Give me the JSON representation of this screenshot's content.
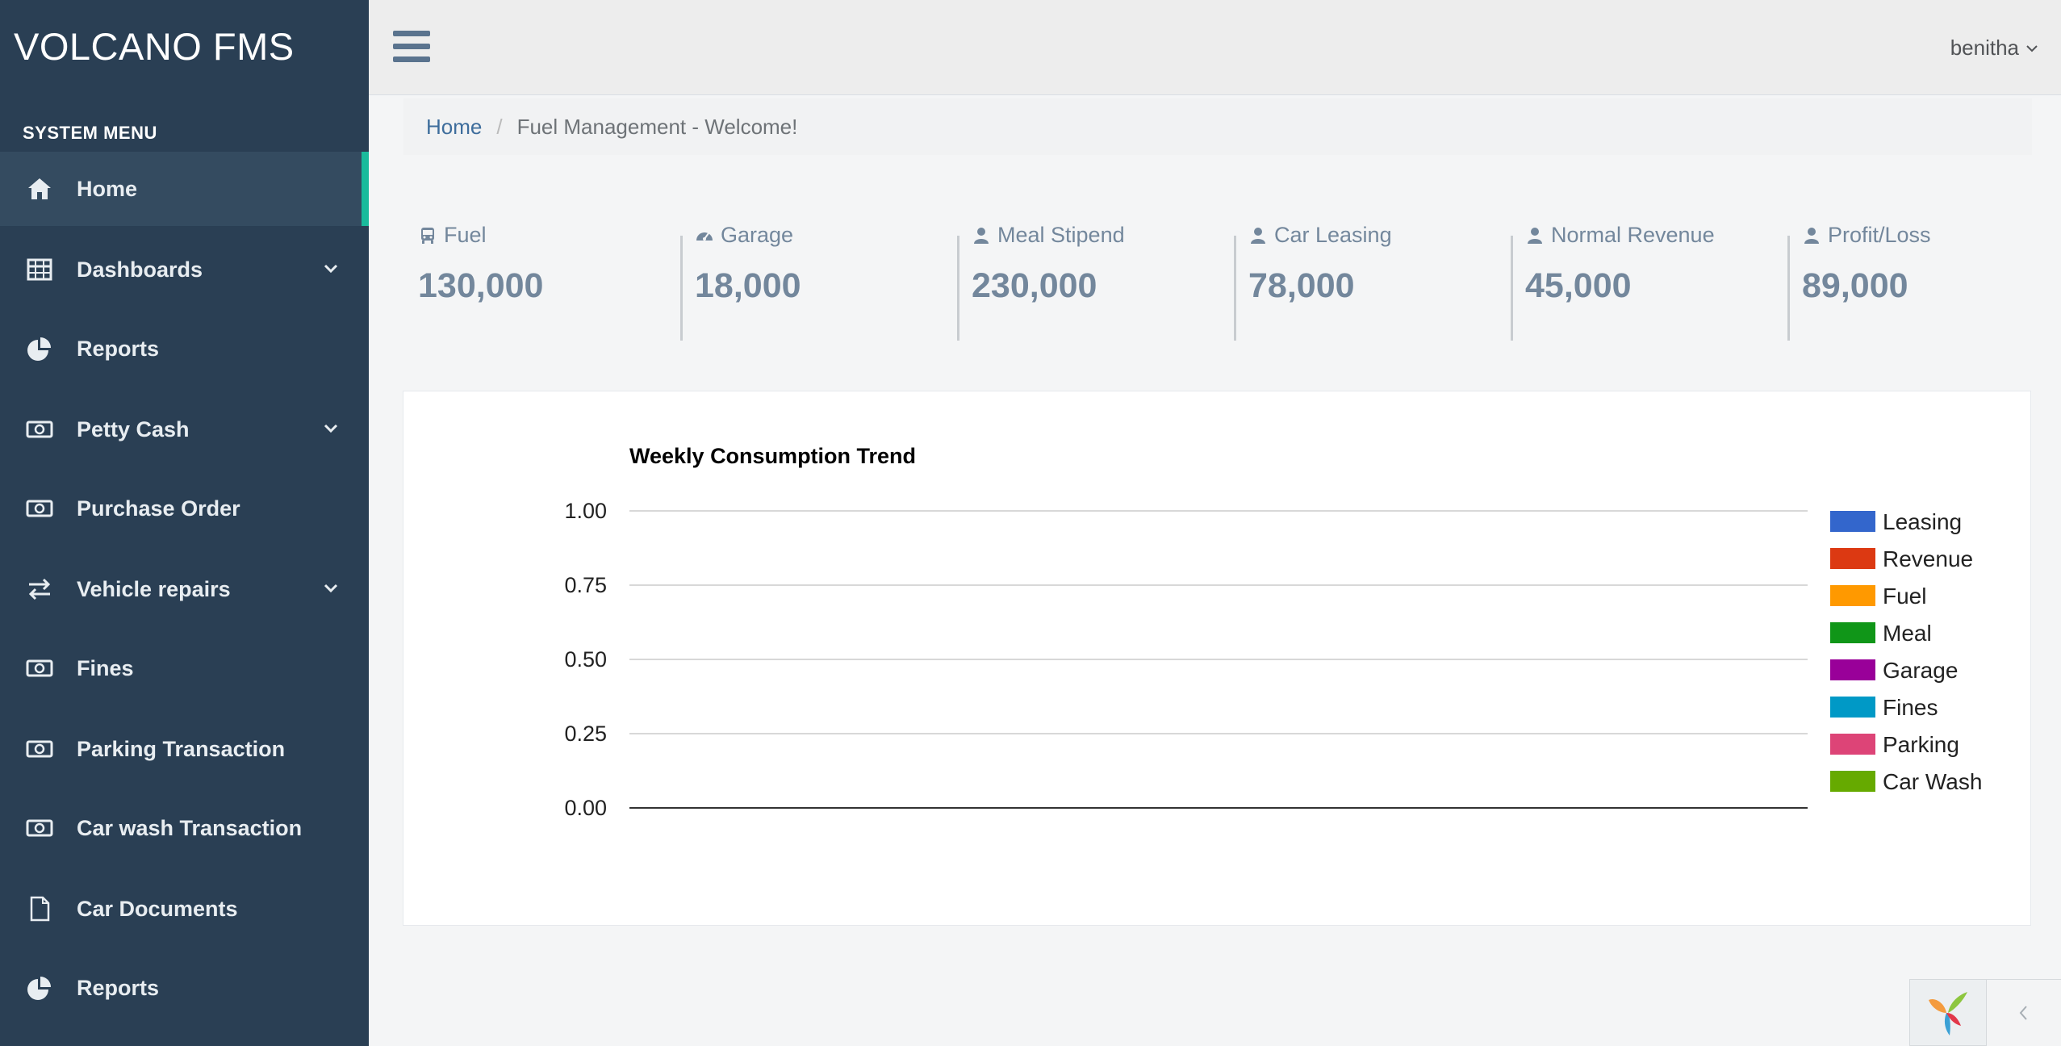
{
  "app": {
    "title": "VOLCANO FMS"
  },
  "sidebar": {
    "menu_title": "SYSTEM MENU",
    "items": [
      {
        "label": "Home",
        "icon": "home-icon",
        "active": true,
        "has_submenu": false
      },
      {
        "label": "Dashboards",
        "icon": "table-icon",
        "active": false,
        "has_submenu": true
      },
      {
        "label": "Reports",
        "icon": "pie-chart-icon",
        "active": false,
        "has_submenu": false
      },
      {
        "label": "Petty Cash",
        "icon": "money-icon",
        "active": false,
        "has_submenu": true
      },
      {
        "label": "Purchase Order",
        "icon": "money-icon",
        "active": false,
        "has_submenu": false
      },
      {
        "label": "Vehicle repairs",
        "icon": "exchange-icon",
        "active": false,
        "has_submenu": true
      },
      {
        "label": "Fines",
        "icon": "money-icon",
        "active": false,
        "has_submenu": false
      },
      {
        "label": "Parking Transaction",
        "icon": "money-icon",
        "active": false,
        "has_submenu": false
      },
      {
        "label": "Car wash Transaction",
        "icon": "money-icon",
        "active": false,
        "has_submenu": false
      },
      {
        "label": "Car Documents",
        "icon": "file-icon",
        "active": false,
        "has_submenu": false
      },
      {
        "label": "Reports",
        "icon": "pie-chart-icon",
        "active": false,
        "has_submenu": false
      }
    ]
  },
  "header": {
    "user": "benitha"
  },
  "breadcrumb": {
    "home": "Home",
    "separator": "/",
    "current": "Fuel Management - Welcome!"
  },
  "stats": [
    {
      "label": "Fuel",
      "value": "130,000",
      "icon": "bus-icon"
    },
    {
      "label": "Garage",
      "value": "18,000",
      "icon": "dashboard-icon"
    },
    {
      "label": "Meal Stipend",
      "value": "230,000",
      "icon": "user-icon"
    },
    {
      "label": "Car Leasing",
      "value": "78,000",
      "icon": "user-icon"
    },
    {
      "label": "Normal Revenue",
      "value": "45,000",
      "icon": "user-icon"
    },
    {
      "label": "Profit/Loss",
      "value": "89,000",
      "icon": "user-icon"
    }
  ],
  "chart_data": {
    "type": "line",
    "title": "Weekly Consumption Trend",
    "xlabel": "",
    "ylabel": "",
    "ylim": [
      0,
      1
    ],
    "yticks": [
      "1.00",
      "0.75",
      "0.50",
      "0.25",
      "0.00"
    ],
    "grid": true,
    "legend_position": "right",
    "series": [
      {
        "name": "Leasing",
        "color": "#3366cc",
        "values": []
      },
      {
        "name": "Revenue",
        "color": "#dc3912",
        "values": []
      },
      {
        "name": "Fuel",
        "color": "#ff9900",
        "values": []
      },
      {
        "name": "Meal",
        "color": "#109618",
        "values": []
      },
      {
        "name": "Garage",
        "color": "#990099",
        "values": []
      },
      {
        "name": "Fines",
        "color": "#0099c6",
        "values": []
      },
      {
        "name": "Parking",
        "color": "#dd4477",
        "values": []
      },
      {
        "name": "Car Wash",
        "color": "#66aa00",
        "values": []
      }
    ]
  },
  "colors": {
    "sidebar": "#2a3f54",
    "accent": "#1abb9c",
    "stat_text": "#73879c"
  }
}
